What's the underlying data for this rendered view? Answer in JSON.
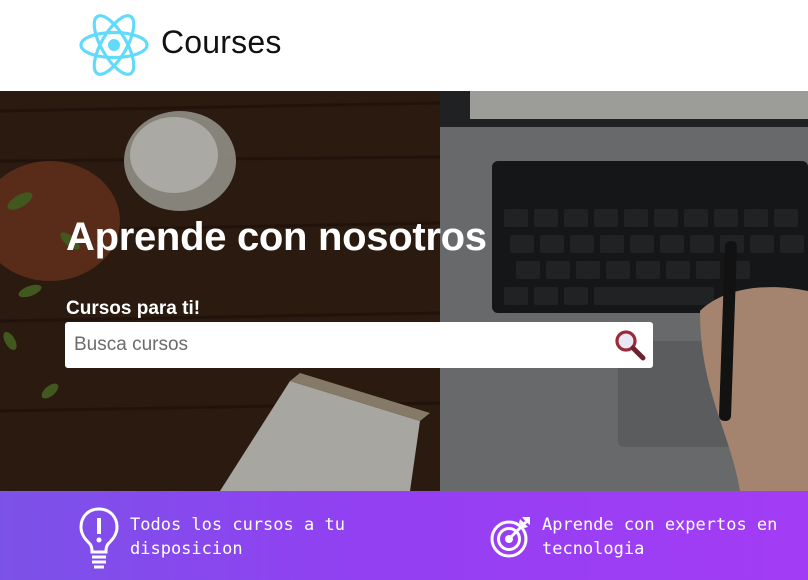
{
  "header": {
    "brand": "Courses",
    "logo_icon": "react-atom-icon",
    "accent": "#61dafb"
  },
  "hero": {
    "title": "Aprende con nosotros",
    "search_label": "Cursos para ti!",
    "search_placeholder": "Busca cursos",
    "search_icon": "magnifier-icon"
  },
  "features": [
    {
      "icon": "lightbulb-icon",
      "text": "Todos los cursos a tu disposicion"
    },
    {
      "icon": "target-icon",
      "text": "Aprende con expertos en tecnologia"
    }
  ],
  "colors": {
    "banner_start": "#7b52e8",
    "banner_end": "#a33cf5"
  }
}
